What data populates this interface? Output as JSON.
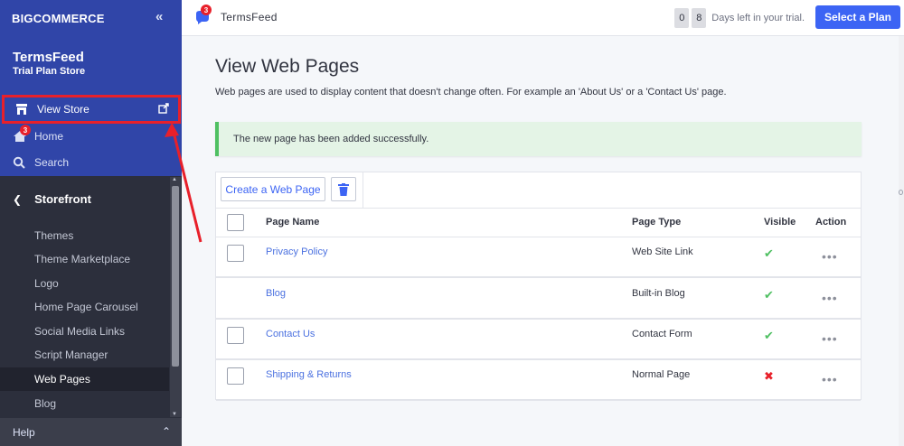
{
  "brand": {
    "logo_prefix": "BIG",
    "logo_suffix": "COMMERCE",
    "collapse_icon": "double-chevron-left"
  },
  "store": {
    "name": "TermsFeed",
    "plan": "Trial Plan Store"
  },
  "sidebar": {
    "view_store": "View Store",
    "home": "Home",
    "home_badge": "3",
    "search": "Search",
    "section": "Storefront",
    "items": [
      {
        "label": "Themes"
      },
      {
        "label": "Theme Marketplace"
      },
      {
        "label": "Logo"
      },
      {
        "label": "Home Page Carousel"
      },
      {
        "label": "Social Media Links"
      },
      {
        "label": "Script Manager"
      },
      {
        "label": "Web Pages"
      },
      {
        "label": "Blog"
      }
    ],
    "active_item": "Web Pages",
    "help": "Help"
  },
  "topbar": {
    "notif_badge": "3",
    "store_name": "TermsFeed",
    "trial_digit_1": "0",
    "trial_digit_2": "8",
    "trial_text": "Days left in your trial.",
    "select_plan": "Select a Plan"
  },
  "main": {
    "title": "View Web Pages",
    "description": "Web pages are used to display content that doesn't change often. For example an 'About Us' or a 'Contact Us' page.",
    "alert": "The new page has been added successfully.",
    "create_button": "Create a Web Page",
    "columns": {
      "name": "Page Name",
      "type": "Page Type",
      "visible": "Visible",
      "action": "Action"
    },
    "rows": [
      {
        "name": "Privacy Policy",
        "type": "Web Site Link",
        "visible": "✔",
        "action": "•••"
      },
      {
        "name": "Blog",
        "type": "Built-in Blog",
        "visible": "✔",
        "action": "•••"
      },
      {
        "name": "Contact Us",
        "type": "Contact Form",
        "visible": "✔",
        "action": "•••"
      },
      {
        "name": "Shipping & Returns",
        "type": "Normal Page",
        "visible": "✖",
        "action": "•••"
      }
    ]
  },
  "colors": {
    "sidebar_top": "#3045a8",
    "sidebar_dark": "#2c2f3c",
    "accent": "#3c64f4",
    "success": "#4fc062",
    "danger": "#e8202a"
  }
}
